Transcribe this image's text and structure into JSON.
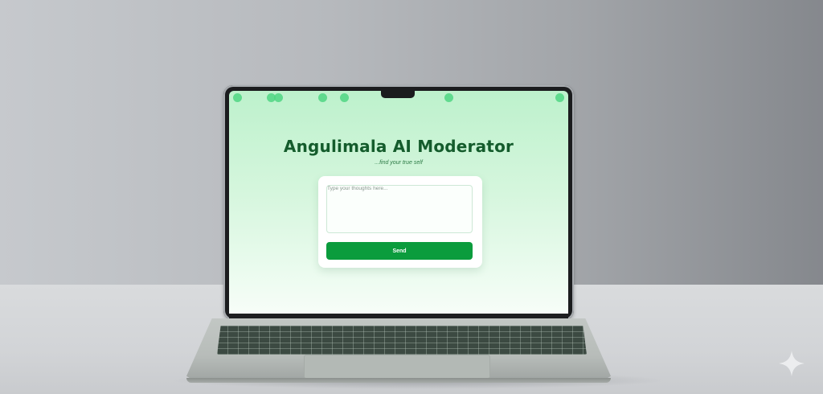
{
  "app": {
    "title": "Angulimala AI Moderator",
    "subtitle": "...find your true self"
  },
  "composer": {
    "placeholder": "Type your thoughts here...",
    "value": "",
    "send_label": "Send"
  },
  "decor": {
    "dot_count": 8
  },
  "colors": {
    "title": "#145c2c",
    "accent": "#0b9c3d",
    "dot": "#4fd682",
    "screen_top": "#bdf1cc"
  },
  "icons": {
    "watermark": "sparkle-icon"
  }
}
